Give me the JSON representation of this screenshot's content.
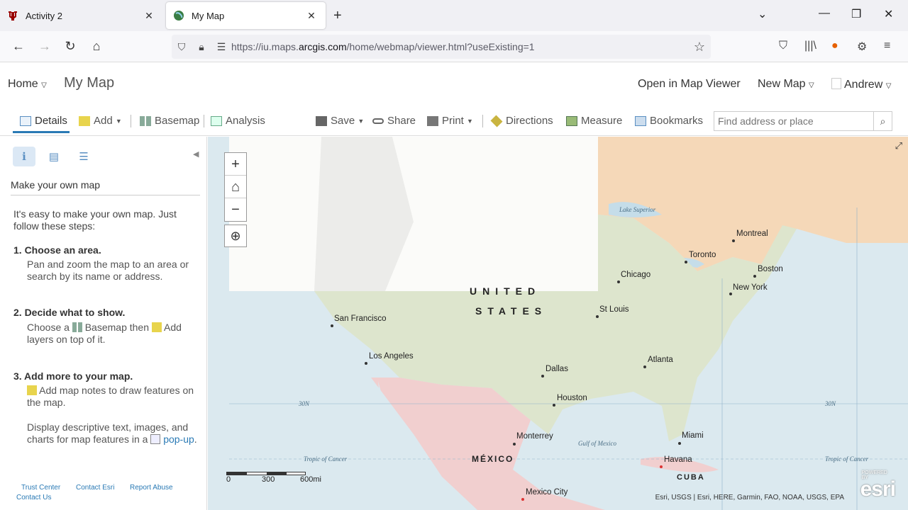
{
  "browser": {
    "tabs": [
      {
        "title": "Activity 2",
        "active": false,
        "favicon": "iu-trident-icon"
      },
      {
        "title": "My Map",
        "active": true,
        "favicon": "globe-icon"
      }
    ],
    "url_prefix": "https://iu.maps.",
    "url_domain": "arcgis.com",
    "url_path": "/home/webmap/viewer.html?useExisting=1"
  },
  "header": {
    "home": "Home",
    "title": "My Map",
    "open_in_viewer": "Open in Map Viewer",
    "new_map": "New Map",
    "user": "Andrew"
  },
  "toolbar": {
    "details": "Details",
    "add": "Add",
    "basemap": "Basemap",
    "analysis": "Analysis",
    "save": "Save",
    "share": "Share",
    "print": "Print",
    "directions": "Directions",
    "measure": "Measure",
    "bookmarks": "Bookmarks",
    "search_placeholder": "Find address or place"
  },
  "sidebar": {
    "heading": "Make your own map",
    "intro": "It's easy to make your own map. Just follow these steps:",
    "step1_title": "1. Choose an area.",
    "step1_text": "Pan and zoom the map to an area or search by its name or address.",
    "step2_title": "2. Decide what to show.",
    "step2_a": "Choose a",
    "step2_b": "Basemap then",
    "step2_c": "Add",
    "step2_d": "layers on top of it.",
    "step3_title": "3. Add more to your map.",
    "step3_a": "Add map notes to draw features on the map.",
    "step3_b": "Display descriptive text, images, and charts for map features in a",
    "step3_link": "pop-up",
    "footer": [
      "Trust Center",
      "Contact Esri",
      "Report Abuse",
      "Contact Us"
    ]
  },
  "map": {
    "country_us_1": "UNITED",
    "country_us_2": "STATES",
    "mexico": "MÉXICO",
    "cuba": "CUBA",
    "cities": [
      "San Francisco",
      "Los Angeles",
      "Dallas",
      "Houston",
      "Atlanta",
      "St Louis",
      "Chicago",
      "Toronto",
      "Montreal",
      "Boston",
      "New York",
      "Miami",
      "Havana",
      "Monterrey",
      "Mexico City"
    ],
    "water_lake": "Lake Superior",
    "water_gulf": "Gulf of Mexico",
    "tropic": "Tropic of Cancer",
    "lat30": "30N",
    "scale": [
      "0",
      "300",
      "600mi"
    ],
    "attribution": "Esri, USGS | Esri, HERE, Garmin, FAO, NOAA, USGS, EPA",
    "logo": "esri",
    "logo_small": "POWERED BY"
  }
}
